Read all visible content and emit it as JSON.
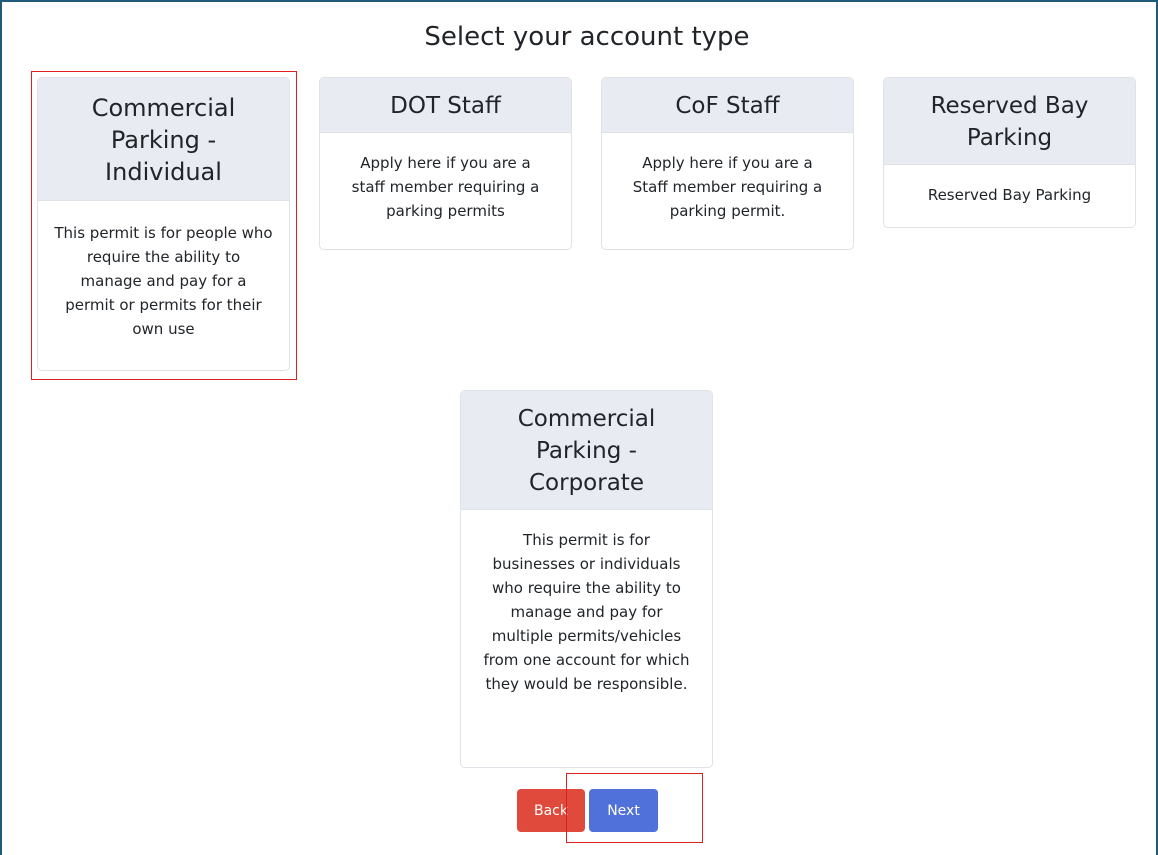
{
  "page": {
    "title": "Select your account type"
  },
  "cards": [
    {
      "title": "Commercial Parking - Individual",
      "description": "This permit is for people who require the ability to manage and pay for a permit or permits for their own use"
    },
    {
      "title": "DOT Staff",
      "description": "Apply here if you are a staff member requiring a parking permits"
    },
    {
      "title": "CoF Staff",
      "description": "Apply here if you are a Staff member requiring a parking permit."
    },
    {
      "title": "Reserved Bay Parking",
      "description": "Reserved Bay Parking"
    },
    {
      "title": "Commercial Parking - Corporate",
      "description": "This permit is for businesses or individuals who require the ability to manage and pay for multiple permits/vehicles from one account for which they would be responsible."
    }
  ],
  "actions": {
    "back_label": "Back",
    "next_label": "Next"
  },
  "colors": {
    "back_button": "#e04a3c",
    "next_button": "#4f71d9",
    "card_header": "#e9ebf2",
    "highlight": "#e02020",
    "frame": "#1f5a7a"
  }
}
